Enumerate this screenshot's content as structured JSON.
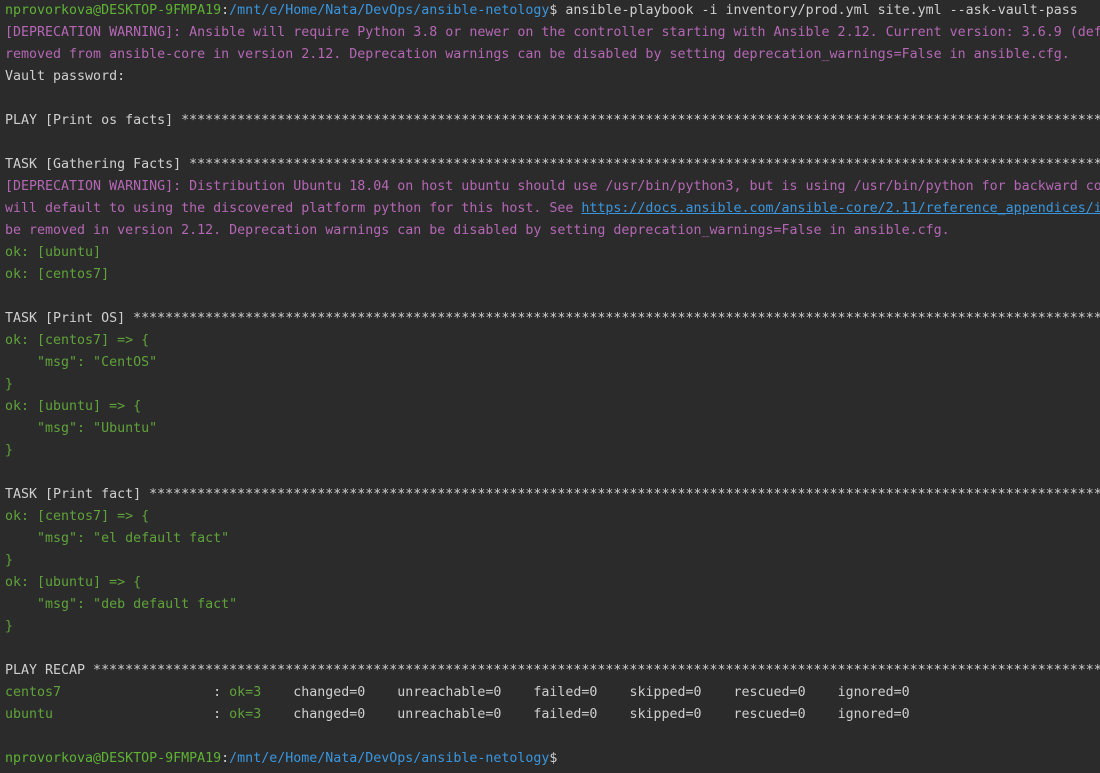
{
  "prompt": {
    "user_host": "nprovorkova@DESKTOP-9FMPA19",
    "colon": ":",
    "path": "/mnt/e/Home/Nata/DevOps/ansible-netology",
    "dollar": "$"
  },
  "command": " ansible-playbook -i inventory/prod.yml site.yml --ask-vault-pass",
  "warning1": {
    "line1": "[DEPRECATION WARNING]: Ansible will require Python 3.8 or newer on the controller starting with Ansible 2.12. Current version: 3.6.9 (def",
    "line2": "removed from ansible-core in version 2.12. Deprecation warnings can be disabled by setting deprecation_warnings=False in ansible.cfg."
  },
  "vault_prompt": "Vault password:",
  "play1_header": "PLAY [Print os facts] *****************************************************************************************************************************",
  "task_gather_header": "TASK [Gathering Facts] ****************************************************************************************************************************",
  "warning2": {
    "line1": "[DEPRECATION WARNING]: Distribution Ubuntu 18.04 on host ubuntu should use /usr/bin/python3, but is using /usr/bin/python for backward co",
    "line2_prefix": "will default to using the discovered platform python for this host. See ",
    "line2_url": "https://docs.ansible.com/ansible-core/2.11/reference_appendices/i",
    "line3": "be removed in version 2.12. Deprecation warnings can be disabled by setting deprecation_warnings=False in ansible.cfg."
  },
  "gather_results": [
    "ok: [ubuntu]",
    "ok: [centos7]"
  ],
  "task_print_os_header": "TASK [Print OS] ***********************************************************************************************************************************",
  "print_os": [
    {
      "host_line": "ok: [centos7] => {",
      "msg_line": "    \"msg\": \"CentOS\"",
      "close": "}"
    },
    {
      "host_line": "ok: [ubuntu] => {",
      "msg_line": "    \"msg\": \"Ubuntu\"",
      "close": "}"
    }
  ],
  "task_print_fact_header": "TASK [Print fact] *********************************************************************************************************************************",
  "print_fact": [
    {
      "host_line": "ok: [centos7] => {",
      "msg_line": "    \"msg\": \"el default fact\"",
      "close": "}"
    },
    {
      "host_line": "ok: [ubuntu] => {",
      "msg_line": "    \"msg\": \"deb default fact\"",
      "close": "}"
    }
  ],
  "recap_header": "PLAY RECAP ************************************************************************************************************************************",
  "recap": [
    {
      "host": "centos7",
      "sep": "                   : ",
      "ok": "ok=3",
      "rest": "    changed=0    unreachable=0    failed=0    skipped=0    rescued=0    ignored=0"
    },
    {
      "host": "ubuntu",
      "sep": "                    : ",
      "ok": "ok=3",
      "rest": "    changed=0    unreachable=0    failed=0    skipped=0    rescued=0    ignored=0"
    }
  ],
  "colors": {
    "background": "#2b2b2b",
    "prompt_user": "#5fb236",
    "prompt_path": "#3a96dd",
    "warning": "#b467b4",
    "ok": "#5fa33a",
    "text": "#cfcfcf"
  }
}
